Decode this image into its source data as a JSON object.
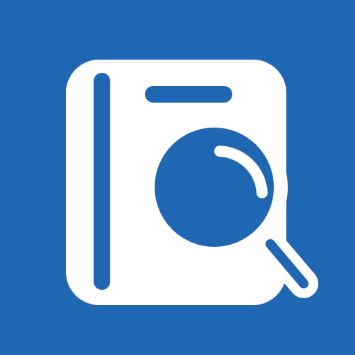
{
  "icon": {
    "name": "book-search-icon",
    "colors": {
      "background": "#2067B3",
      "foreground": "#FFFFFF"
    }
  }
}
